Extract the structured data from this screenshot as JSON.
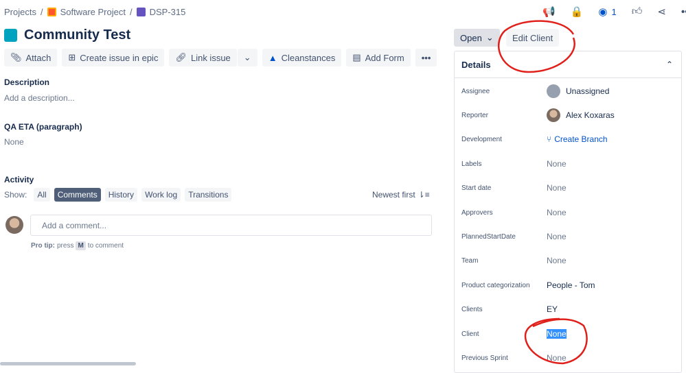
{
  "breadcrumbs": [
    "Projects",
    "Software Project",
    "DSP-315"
  ],
  "issue": {
    "title": "Community Test"
  },
  "toolbar": {
    "attach": "Attach",
    "create_issue": "Create issue in epic",
    "link_issue": "Link issue",
    "cleanstances": "Cleanstances",
    "add_form": "Add Form"
  },
  "description": {
    "heading": "Description",
    "placeholder": "Add a description..."
  },
  "qa_eta": {
    "heading": "QA ETA (paragraph)",
    "value": "None"
  },
  "activity": {
    "heading": "Activity",
    "show_label": "Show:",
    "filters": [
      "All",
      "Comments",
      "History",
      "Work log",
      "Transitions"
    ],
    "selected": "Comments",
    "sort": "Newest first",
    "comment_placeholder": "Add a comment...",
    "pro_tip_label": "Pro tip:",
    "pro_tip_press": "press",
    "pro_tip_key": "M",
    "pro_tip_end": "to comment"
  },
  "header_actions": {
    "watch_count": "1"
  },
  "status": {
    "open": "Open",
    "edit_client": "Edit Client"
  },
  "details": {
    "heading": "Details",
    "fields": [
      {
        "label": "Assignee",
        "value": "Unassigned"
      },
      {
        "label": "Reporter",
        "value": "Alex Koxaras"
      },
      {
        "label": "Development",
        "value": "Create Branch"
      },
      {
        "label": "Labels",
        "value": "None"
      },
      {
        "label": "Start date",
        "value": "None"
      },
      {
        "label": "Approvers",
        "value": "None"
      },
      {
        "label": "PlannedStartDate",
        "value": "None"
      },
      {
        "label": "Team",
        "value": "None"
      },
      {
        "label": "Product categorization",
        "value": "People - Tom"
      },
      {
        "label": "Clients",
        "value": "EY"
      },
      {
        "label": "Client",
        "value": "None"
      },
      {
        "label": "Previous Sprint",
        "value": "None"
      }
    ]
  },
  "colors": {
    "accent": "#0052cc",
    "annotation": "#e0201b",
    "issue": "#00a3bf"
  }
}
